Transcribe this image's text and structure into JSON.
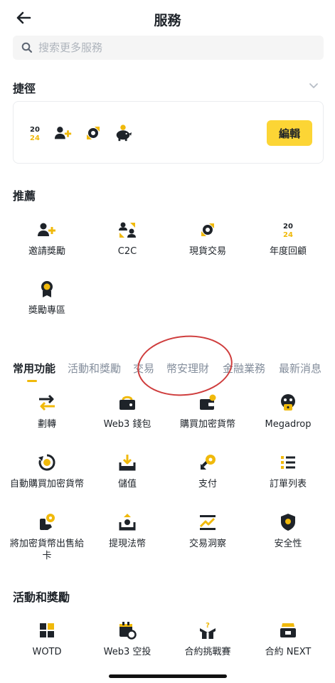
{
  "header": {
    "title": "服務"
  },
  "search": {
    "placeholder": "搜索更多服務"
  },
  "shortcuts": {
    "title": "捷徑",
    "icons": [
      "2024-review-icon",
      "invite-user-icon",
      "spot-trade-icon",
      "piggy-bank-icon"
    ],
    "edit_label": "編輯"
  },
  "recommended": {
    "title": "推薦",
    "items": [
      {
        "label": "邀請獎勵",
        "icon": "invite-user-icon"
      },
      {
        "label": "C2C",
        "icon": "c2c-users-icon"
      },
      {
        "label": "現貨交易",
        "icon": "spot-trade-icon"
      },
      {
        "label": "年度回顧",
        "icon": "2024-review-icon"
      },
      {
        "label": "獎勵專區",
        "icon": "reward-medal-icon"
      }
    ]
  },
  "tabs": {
    "items": [
      "常用功能",
      "活動和獎勵",
      "交易",
      "幣安理財",
      "金融業務",
      "最新消息"
    ],
    "active": "常用功能"
  },
  "common": {
    "items": [
      {
        "label": "劃轉",
        "icon": "transfer-arrows-icon"
      },
      {
        "label": "Web3 錢包",
        "icon": "web3-wallet-icon"
      },
      {
        "label": "購買加密貨幣",
        "icon": "buy-crypto-icon"
      },
      {
        "label": "Megadrop",
        "icon": "megadrop-icon"
      },
      {
        "label": "自動購買加密貨幣",
        "icon": "auto-invest-icon"
      },
      {
        "label": "儲值",
        "icon": "deposit-icon"
      },
      {
        "label": "支付",
        "icon": "pay-icon"
      },
      {
        "label": "訂單列表",
        "icon": "order-list-icon"
      },
      {
        "label": "將加密貨幣出售給卡",
        "icon": "sell-to-card-icon"
      },
      {
        "label": "提現法幣",
        "icon": "withdraw-fiat-icon"
      },
      {
        "label": "交易洞察",
        "icon": "trade-insight-icon"
      },
      {
        "label": "安全性",
        "icon": "security-shield-icon"
      }
    ]
  },
  "activities": {
    "title": "活動和獎勵",
    "items": [
      {
        "label": "WOTD",
        "icon": "wotd-icon"
      },
      {
        "label": "Web3 空投",
        "icon": "web3-airdrop-icon"
      },
      {
        "label": "合約挑戰賽",
        "icon": "futures-challenge-icon"
      },
      {
        "label": "合約 NEXT",
        "icon": "futures-next-icon"
      }
    ]
  },
  "colors": {
    "accent": "#F0B90B",
    "button": "#FCD535",
    "text": "#1E2329",
    "muted": "#848E9C",
    "annotation": "#CF3D3D"
  }
}
